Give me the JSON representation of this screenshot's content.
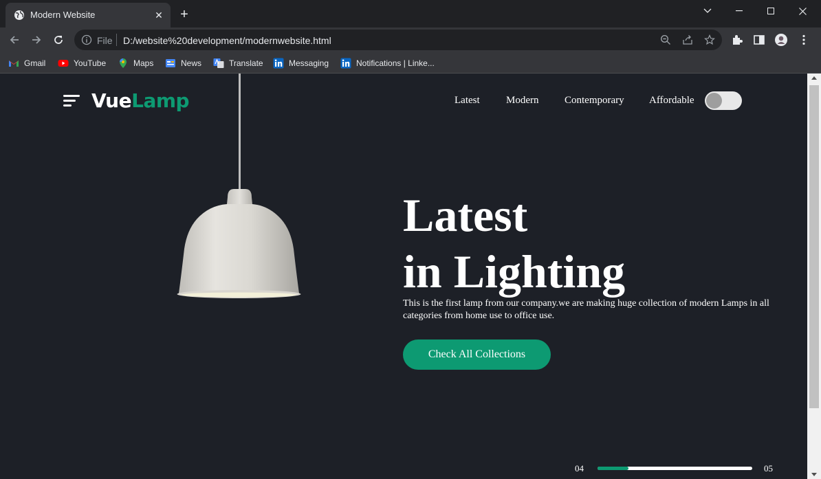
{
  "browser": {
    "tab_title": "Modern Website",
    "new_tab": "+",
    "address_scheme": "File",
    "address_url": "D:/website%20development/modernwebsite.html",
    "bookmarks": [
      {
        "label": "Gmail",
        "icon": "gmail-icon",
        "color": "#ea4335"
      },
      {
        "label": "YouTube",
        "icon": "youtube-icon",
        "color": "#ff0000"
      },
      {
        "label": "Maps",
        "icon": "maps-icon",
        "color": "#34a853"
      },
      {
        "label": "News",
        "icon": "news-icon",
        "color": "#4285f4"
      },
      {
        "label": "Translate",
        "icon": "translate-icon",
        "color": "#4285f4"
      },
      {
        "label": "Messaging",
        "icon": "linkedin-icon",
        "color": "#0a66c2"
      },
      {
        "label": "Notifications | Linke...",
        "icon": "linkedin-icon",
        "color": "#0a66c2"
      }
    ]
  },
  "site": {
    "logo_part1": "Vue",
    "logo_part2": "Lamp",
    "nav": [
      "Latest",
      "Modern",
      "Contemporary",
      "Affordable"
    ],
    "theme_toggle_on": false,
    "hero_title_line1": "Latest",
    "hero_title_line2": "in Lighting",
    "hero_description": "This is the first lamp from our company.we are making huge collection of modern Lamps in all categories from home use to office use.",
    "cta_label": "Check All Collections",
    "slider": {
      "current": "04",
      "total": "05",
      "progress": 0.2
    },
    "colors": {
      "accent": "#0d9a72",
      "background": "#1d2027",
      "text": "#ffffff"
    }
  }
}
